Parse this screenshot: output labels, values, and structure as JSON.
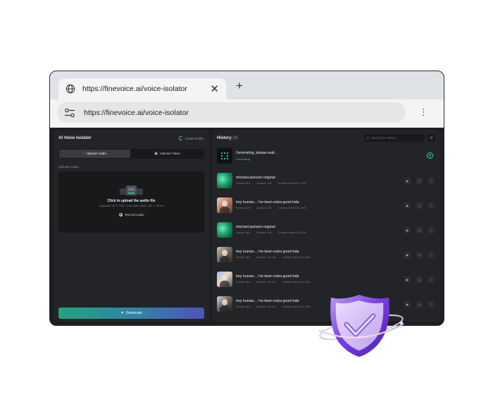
{
  "browser": {
    "tab_title": "https://finevoice.ai/voice-isolator",
    "close_glyph": "✕",
    "newtab_glyph": "+",
    "address": "https://finevoice.ai/voice-isolator",
    "menu_glyph": "⋮"
  },
  "left": {
    "title": "AI Voice Isolator",
    "credits": "8,538 credits",
    "tabs": [
      {
        "label": "Upload Audio",
        "icon": "audio-wave-icon",
        "active": true
      },
      {
        "label": "Upload Video",
        "icon": "video-icon",
        "active": false
      }
    ],
    "upload_label": "Upload Audio",
    "dropzone": {
      "main": "Click to upload the audio file",
      "sub": "Supported: MP3, FLAC, M4A, WAV, WMA, AAC, 1.28 min",
      "record": "Record Audio"
    },
    "generate": "Generate"
  },
  "history": {
    "title": "History",
    "count": "(6)",
    "search_placeholder": "Search for Voices",
    "generating": {
      "title": "Generating, please wait...",
      "status": "Generating"
    },
    "items": [
      {
        "name": "michael-jackson-original",
        "format": "Format: Mp4",
        "duration": "Duration: 35s",
        "created": "Created: March 02, 2026",
        "thumb": "green"
      },
      {
        "name": "hey human... i've been extra good toda",
        "format": "Format: Mp4",
        "duration": "Duration: 35s",
        "created": "Created: March 02, 2026",
        "thumb": "person1"
      },
      {
        "name": "michael-jackson-original",
        "format": "Format: Mp4",
        "duration": "Duration: 35s",
        "created": "Created: March 02, 2026",
        "thumb": "green"
      },
      {
        "name": "hey human... i've been extra good toda",
        "format": "Format: Mp4",
        "duration": "Duration: 1m 15s",
        "created": "Created: March 30, 2026",
        "thumb": "person2"
      },
      {
        "name": "hey human... i've been extra good toda",
        "format": "Format: Mp4",
        "duration": "Duration: 1m 15s",
        "created": "Created: March 30, 2026",
        "thumb": "person3"
      },
      {
        "name": "hey human... i've been extra good toda",
        "format": "Format: Mp4",
        "duration": "Duration: 1m 15s",
        "created": "Created: March 30, 2026",
        "thumb": "person4"
      }
    ]
  },
  "icons": {
    "play": "▶",
    "download": "⇣",
    "more": "⋮",
    "search": "⌕",
    "filter": "⇵",
    "gear": "⚙"
  },
  "colors": {
    "accent_green": "#2ed19a",
    "panel_bg": "#232427",
    "window_bg": "#1d1e20",
    "gradient_start": "#23a37f",
    "gradient_end": "#4e55b8",
    "shield_purple": "#7b3fe4"
  }
}
